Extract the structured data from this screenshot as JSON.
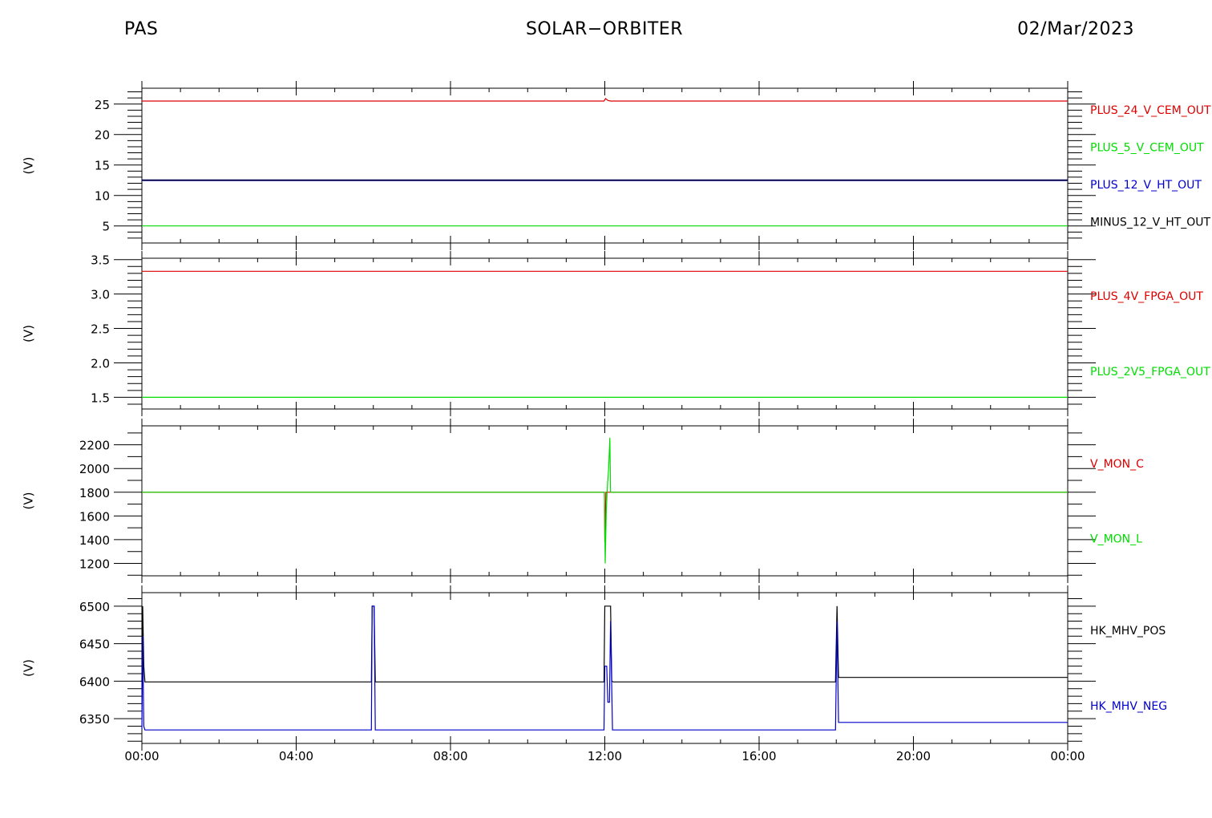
{
  "header": {
    "left": "PAS",
    "center": "SOLAR−ORBITER",
    "right": "02/Mar/2023"
  },
  "colors": {
    "red": "#dd0000",
    "green": "#00dd00",
    "blue": "#0000cc",
    "black": "#000000"
  },
  "chart_data": [
    {
      "type": "line",
      "ylabel": "(V)",
      "ylim": [
        2.2,
        27.6
      ],
      "yticks": [
        5,
        10,
        15,
        20,
        25
      ],
      "minor_step": 1,
      "x_range_hours": [
        0,
        24
      ],
      "series": [
        {
          "name": "PLUS_24_V_CEM_OUT",
          "color": "#dd0000",
          "x": [
            0,
            11.98,
            12.02,
            12.08,
            12.15,
            24
          ],
          "y": [
            25.5,
            25.5,
            25.9,
            25.6,
            25.5,
            25.5
          ]
        },
        {
          "name": "PLUS_5_V_CEM_OUT",
          "color": "#00dd00",
          "x": [
            0,
            24
          ],
          "y": [
            5.0,
            5.0
          ]
        },
        {
          "name": "PLUS_12_V_HT_OUT",
          "color": "#0000cc",
          "x": [
            0,
            24
          ],
          "y": [
            12.5,
            12.5
          ]
        },
        {
          "name": "MINUS_12_V_HT_OUT",
          "color": "#000000",
          "x": [
            0,
            24
          ],
          "y": [
            12.5,
            12.5
          ]
        }
      ]
    },
    {
      "type": "line",
      "ylabel": "(V)",
      "ylim": [
        1.33,
        3.52
      ],
      "yticks": [
        1.5,
        2.0,
        2.5,
        3.0,
        3.5
      ],
      "minor_step": 0.1,
      "x_range_hours": [
        0,
        24
      ],
      "series": [
        {
          "name": "PLUS_4V_FPGA_OUT",
          "color": "#dd0000",
          "x": [
            0,
            24
          ],
          "y": [
            3.33,
            3.33
          ]
        },
        {
          "name": "PLUS_2V5_FPGA_OUT",
          "color": "#00dd00",
          "x": [
            0,
            24
          ],
          "y": [
            1.5,
            1.5
          ]
        }
      ]
    },
    {
      "type": "line",
      "ylabel": "(V)",
      "ylim": [
        1095,
        2360
      ],
      "yticks": [
        1200,
        1400,
        1600,
        1800,
        2000,
        2200
      ],
      "minor_step": 100,
      "x_range_hours": [
        0,
        24
      ],
      "series": [
        {
          "name": "V_MON_C",
          "color": "#dd0000",
          "x": [
            0,
            11.99,
            12.0,
            12.03,
            12.06,
            24
          ],
          "y": [
            1800,
            1800,
            1380,
            1800,
            1800,
            1800
          ]
        },
        {
          "name": "V_MON_L",
          "color": "#00dd00",
          "x": [
            0,
            11.99,
            12.01,
            12.04,
            12.07,
            12.1,
            12.13,
            12.15,
            24
          ],
          "y": [
            1800,
            1800,
            1200,
            1650,
            1870,
            2000,
            2260,
            1800,
            1800
          ]
        }
      ]
    },
    {
      "type": "line",
      "ylabel": "(V)",
      "ylim": [
        6317,
        6518
      ],
      "yticks": [
        6350,
        6400,
        6450,
        6500
      ],
      "minor_step": 10,
      "x_range_hours": [
        0,
        24
      ],
      "series": [
        {
          "name": "HK_MHV_POS",
          "color": "#000000",
          "x": [
            0,
            0.02,
            0.05,
            0.08,
            5.95,
            5.97,
            6.02,
            6.05,
            11.98,
            12.0,
            12.02,
            12.15,
            12.18,
            12.22,
            17.98,
            18.02,
            18.06,
            24
          ],
          "y": [
            6400,
            6500,
            6420,
            6399,
            6399,
            6500,
            6500,
            6399,
            6399,
            6500,
            6500,
            6500,
            6400,
            6399,
            6399,
            6500,
            6405,
            6405
          ]
        },
        {
          "name": "HK_MHV_NEG",
          "color": "#0000cc",
          "x": [
            0,
            0.02,
            0.05,
            0.08,
            5.95,
            5.97,
            6.02,
            6.05,
            11.98,
            12.0,
            12.05,
            12.08,
            12.12,
            12.15,
            12.2,
            17.98,
            18.02,
            18.06,
            24
          ],
          "y": [
            6336,
            6460,
            6340,
            6335,
            6335,
            6500,
            6500,
            6335,
            6335,
            6420,
            6420,
            6372,
            6372,
            6480,
            6335,
            6335,
            6480,
            6345,
            6345
          ]
        }
      ]
    }
  ],
  "x_axis": {
    "ticks_hours": [
      0,
      4,
      8,
      12,
      16,
      20,
      24
    ],
    "tick_labels": [
      "00:00",
      "04:00",
      "08:00",
      "12:00",
      "16:00",
      "20:00",
      "00:00"
    ],
    "minor_step_hours": 1
  }
}
